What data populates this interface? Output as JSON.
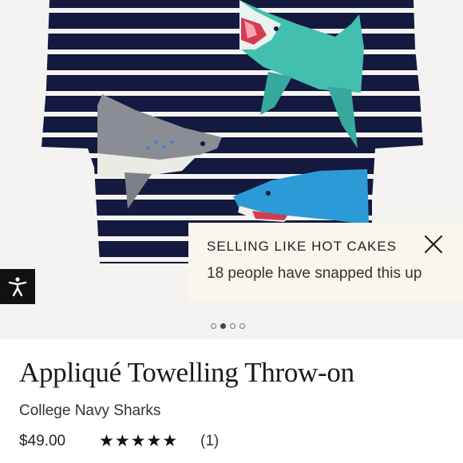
{
  "carousel": {
    "image_alt": "Appliqué Towelling Throw-on in College Navy Sharks",
    "dot_count": 4,
    "active_index": 1
  },
  "toast": {
    "title": "SELLING LIKE HOT CAKES",
    "message": "18 people have snapped this up",
    "close_icon": "close-icon"
  },
  "accessibility": {
    "icon": "accessibility-icon"
  },
  "product": {
    "title": "Appliqué Towelling Throw-on",
    "colour": "College Navy Sharks",
    "price": "$49.00",
    "rating": 5,
    "rating_max": 5,
    "review_count": "(1)"
  },
  "colors": {
    "navy": "#14193f",
    "stripe": "#f5f4f0",
    "toast_bg": "#faf6ee",
    "background": "#f4f3f1"
  }
}
